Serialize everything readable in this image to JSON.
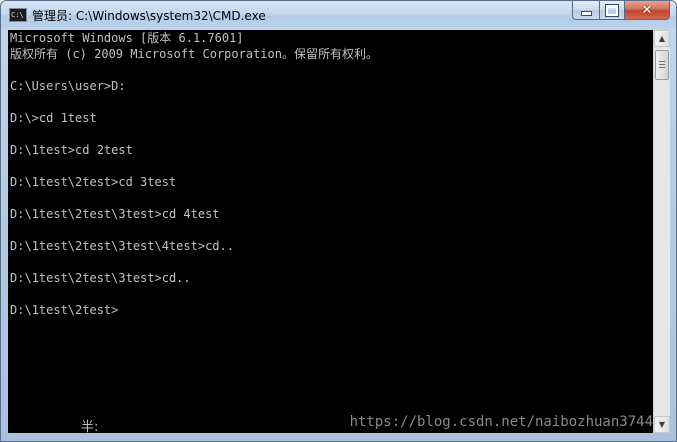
{
  "window": {
    "title": "管理员: C:\\Windows\\system32\\CMD.exe",
    "icon": "cmd-icon",
    "icon_text": "C:\\",
    "controls": {
      "minimize": "minimize-icon",
      "maximize": "maximize-icon",
      "close": "close-icon",
      "close_color": "#c0442a"
    }
  },
  "console": {
    "background": "#000000",
    "foreground": "#c0c0c0",
    "lines": [
      "Microsoft Windows [版本 6.1.7601]",
      "版权所有 (c) 2009 Microsoft Corporation。保留所有权利。",
      "",
      "C:\\Users\\user>D:",
      "",
      "D:\\>cd 1test",
      "",
      "D:\\1test>cd 2test",
      "",
      "D:\\1test\\2test>cd 3test",
      "",
      "D:\\1test\\2test\\3test>cd 4test",
      "",
      "D:\\1test\\2test\\3test\\4test>cd..",
      "",
      "D:\\1test\\2test\\3test>cd..",
      "",
      "D:\\1test\\2test>"
    ],
    "ime_status": "半:",
    "watermark": "https://blog.csdn.net/naibozhuan3744"
  },
  "scrollbar": {
    "up_icon": "arrow-up-icon",
    "down_icon": "arrow-down-icon"
  }
}
